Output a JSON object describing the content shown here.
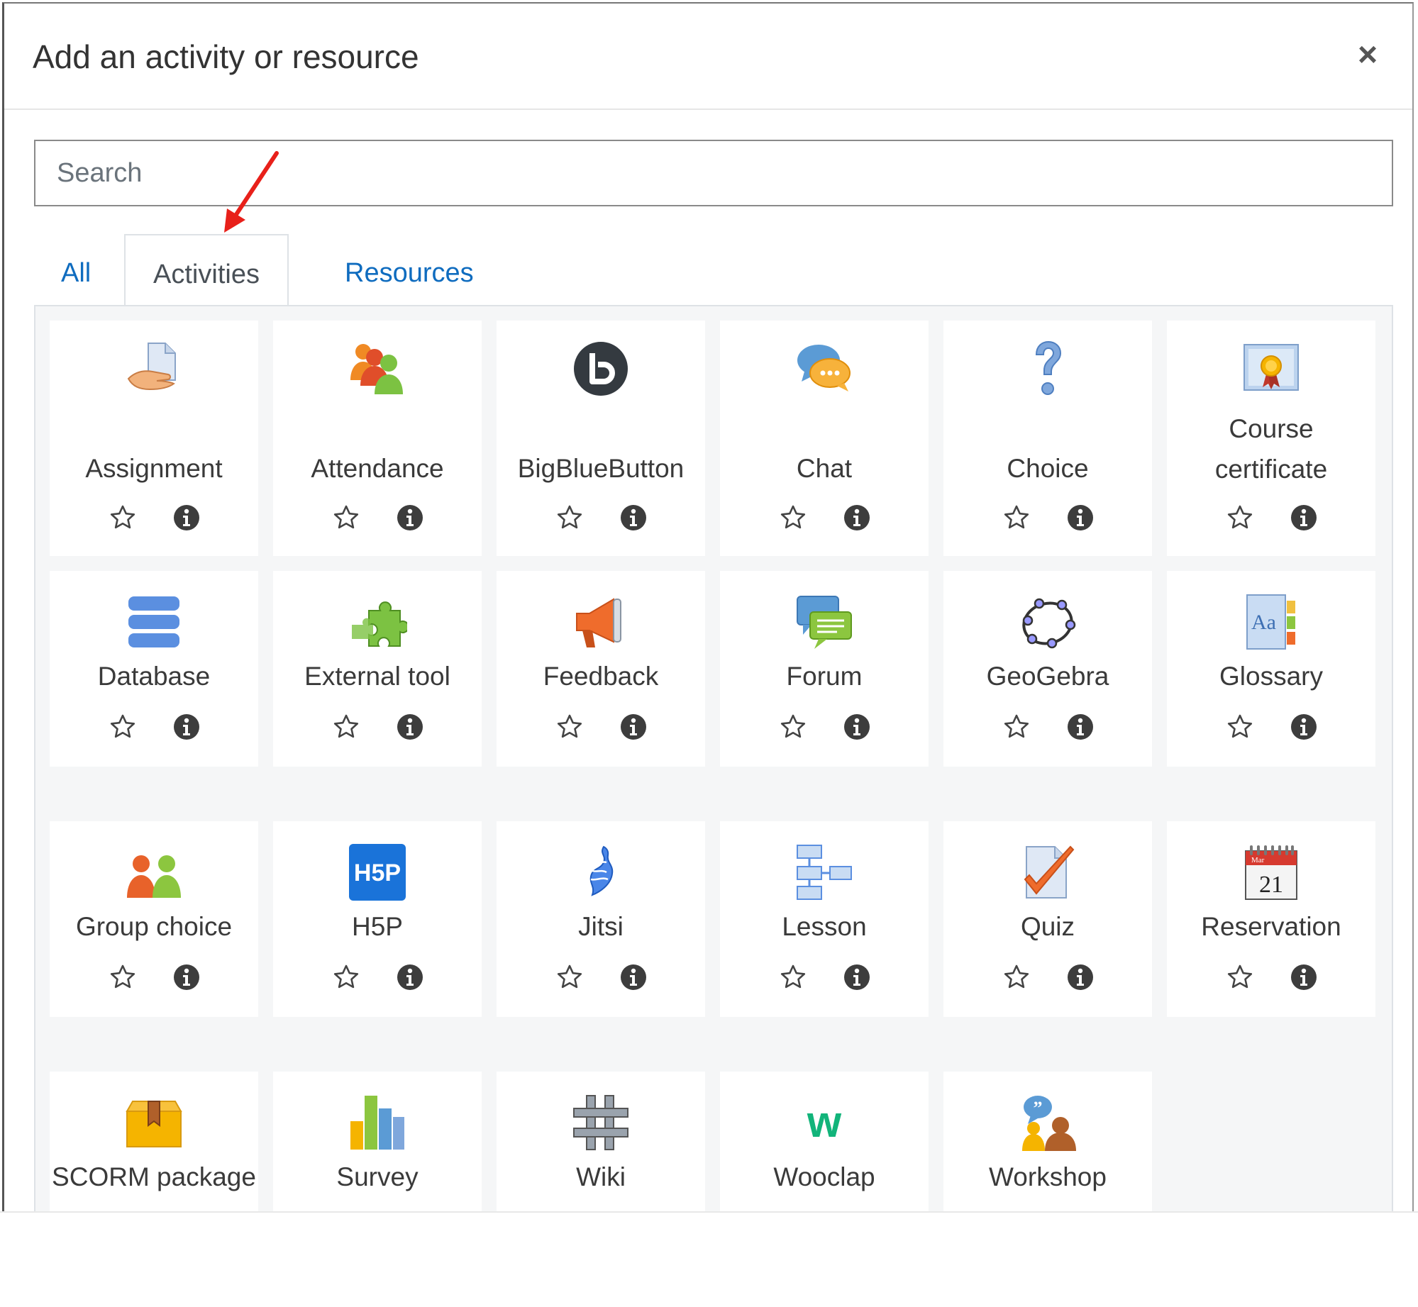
{
  "modal": {
    "title": "Add an activity or resource",
    "close_label": "×"
  },
  "search": {
    "placeholder": "Search",
    "value": ""
  },
  "tabs": [
    {
      "label": "All",
      "active": false
    },
    {
      "label": "Activities",
      "active": true
    },
    {
      "label": "Resources",
      "active": false
    }
  ],
  "tiles": [
    {
      "label": "Assignment",
      "icon": "assignment-icon"
    },
    {
      "label": "Attendance",
      "icon": "attendance-icon"
    },
    {
      "label": "BigBlueButton",
      "icon": "bigbluebutton-icon"
    },
    {
      "label": "Chat",
      "icon": "chat-icon"
    },
    {
      "label": "Choice",
      "icon": "choice-icon"
    },
    {
      "label": "Course certificate",
      "label_line1": "Course",
      "label_line2": "certificate",
      "icon": "certificate-icon"
    },
    {
      "label": "Database",
      "icon": "database-icon"
    },
    {
      "label": "External tool",
      "icon": "external-tool-icon"
    },
    {
      "label": "Feedback",
      "icon": "feedback-icon"
    },
    {
      "label": "Forum",
      "icon": "forum-icon"
    },
    {
      "label": "GeoGebra",
      "icon": "geogebra-icon"
    },
    {
      "label": "Glossary",
      "icon": "glossary-icon"
    },
    {
      "label": "Group choice",
      "icon": "group-choice-icon"
    },
    {
      "label": "H5P",
      "icon": "h5p-icon",
      "icon_text": "H5P"
    },
    {
      "label": "Jitsi",
      "icon": "jitsi-icon"
    },
    {
      "label": "Lesson",
      "icon": "lesson-icon"
    },
    {
      "label": "Quiz",
      "icon": "quiz-icon"
    },
    {
      "label": "Reservation",
      "icon": "reservation-icon",
      "icon_text_top": "Mar",
      "icon_text": "21"
    },
    {
      "label": "SCORM package",
      "icon": "scorm-icon"
    },
    {
      "label": "Survey",
      "icon": "survey-icon"
    },
    {
      "label": "Wiki",
      "icon": "wiki-icon"
    },
    {
      "label": "Wooclap",
      "icon": "wooclap-icon",
      "icon_text": "w"
    },
    {
      "label": "Workshop",
      "icon": "workshop-icon",
      "icon_text": "”"
    }
  ],
  "colors": {
    "link": "#0f6cbf",
    "tab_active_text": "#495057",
    "content_bg": "#f5f6f7",
    "annotation_arrow": "#e8201a"
  }
}
